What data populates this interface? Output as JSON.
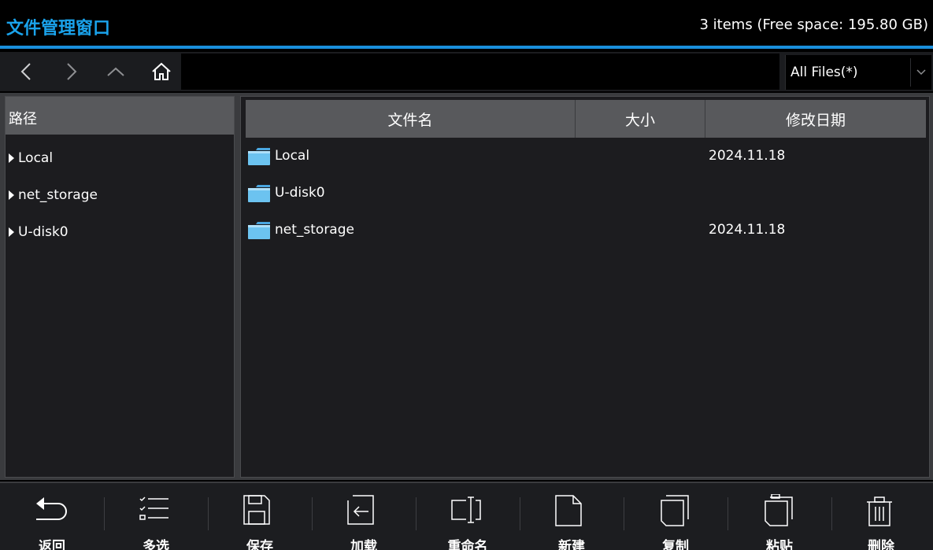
{
  "window": {
    "title": "文件管理窗口",
    "status": "3 items (Free space: 195.80 GB)"
  },
  "nav": {
    "back_icon": "chevron-left-icon",
    "forward_icon": "chevron-right-icon",
    "up_icon": "chevron-up-icon",
    "home_icon": "home-icon",
    "filter_value": "All Files(*)"
  },
  "sidebar": {
    "header": "路径",
    "items": [
      {
        "label": "Local"
      },
      {
        "label": "net_storage"
      },
      {
        "label": "U-disk0"
      }
    ]
  },
  "filelist": {
    "columns": {
      "name": "文件名",
      "size": "大小",
      "modified": "修改日期"
    },
    "rows": [
      {
        "name": "Local",
        "size": "",
        "modified": "2024.11.18"
      },
      {
        "name": "U-disk0",
        "size": "",
        "modified": ""
      },
      {
        "name": "net_storage",
        "size": "",
        "modified": "2024.11.18"
      }
    ]
  },
  "toolbar": {
    "items": [
      {
        "label": "返回",
        "icon": "return-icon"
      },
      {
        "label": "多选",
        "icon": "multi-select-icon"
      },
      {
        "label": "保存",
        "icon": "save-icon"
      },
      {
        "label": "加载",
        "icon": "load-icon"
      },
      {
        "label": "重命名",
        "icon": "rename-icon"
      },
      {
        "label": "新建",
        "icon": "new-file-icon"
      },
      {
        "label": "复制",
        "icon": "copy-icon"
      },
      {
        "label": "粘贴",
        "icon": "paste-icon"
      },
      {
        "label": "删除",
        "icon": "delete-icon"
      }
    ]
  },
  "colors": {
    "accent": "#1aa3ec",
    "folder": "#6cc3f0"
  }
}
